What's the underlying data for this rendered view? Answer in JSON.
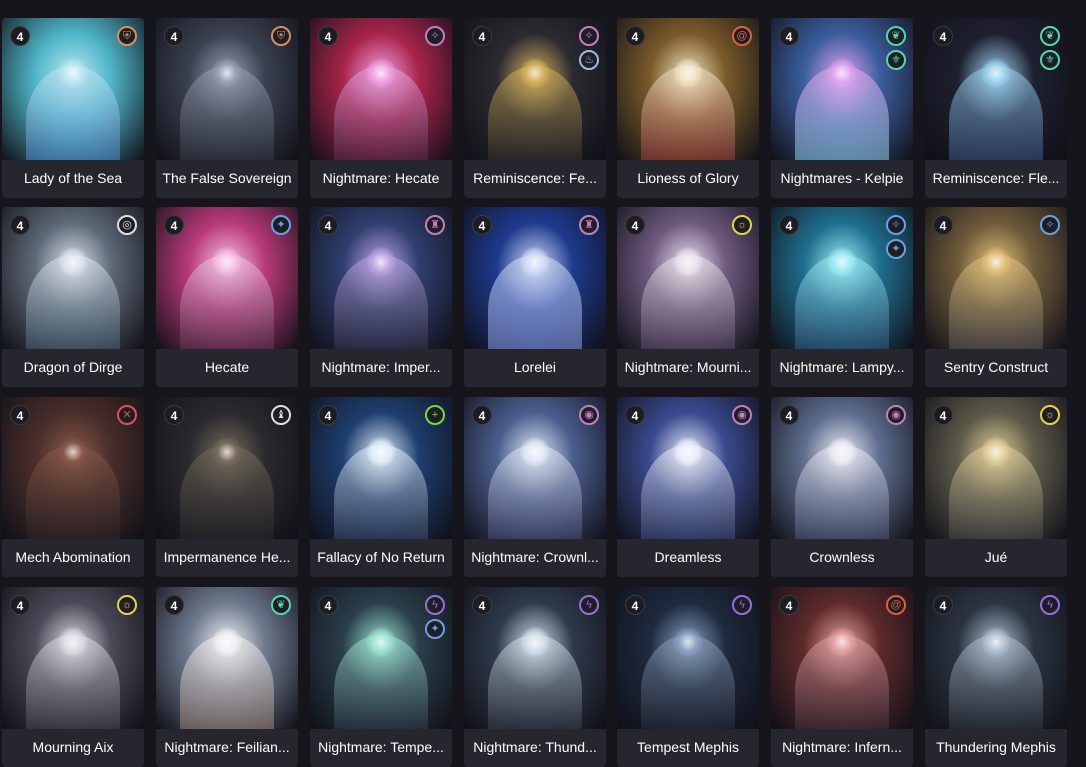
{
  "cards": [
    {
      "name": "Lady of the Sea",
      "level": "4",
      "colors": [
        "#4fb6c9",
        "#bfe9f3",
        "#3b78c4"
      ],
      "badges": [
        {
          "icon": "shield-icon",
          "color": "#d9905a",
          "glyph": "⛨"
        }
      ]
    },
    {
      "name": "The False Sovereign",
      "level": "4",
      "colors": [
        "#3b4150",
        "#9aa3b5",
        "#20242e"
      ],
      "badges": [
        {
          "icon": "shield-icon",
          "color": "#d9905a",
          "glyph": "⛨"
        }
      ]
    },
    {
      "name": "Nightmare: Hecate",
      "level": "4",
      "colors": [
        "#a8244a",
        "#f3a4e6",
        "#3e1530"
      ],
      "badges": [
        {
          "icon": "wings-icon",
          "color": "#c77ec0",
          "glyph": "✧"
        }
      ]
    },
    {
      "name": "Reminiscence: Fe...",
      "level": "4",
      "colors": [
        "#2a2a30",
        "#d9b45c",
        "#1a1a1f"
      ],
      "badges": [
        {
          "icon": "wings-icon",
          "color": "#c77ec0",
          "glyph": "✧"
        },
        {
          "icon": "flame-icon",
          "color": "#9fbbe0",
          "glyph": "♨"
        }
      ]
    },
    {
      "name": "Lioness of Glory",
      "level": "4",
      "colors": [
        "#7a5a2a",
        "#f3e6c4",
        "#8a2020"
      ],
      "badges": [
        {
          "icon": "spiral-icon",
          "color": "#e0603a",
          "glyph": "@"
        }
      ]
    },
    {
      "name": "Nightmares - Kelpie",
      "level": "4",
      "colors": [
        "#3b5e9e",
        "#e6a4f0",
        "#7fd6e6"
      ],
      "badges": [
        {
          "icon": "leaf-icon",
          "color": "#57d6a8",
          "glyph": "❦"
        },
        {
          "icon": "fleur-icon",
          "color": "#57d6a8",
          "glyph": "⚜"
        }
      ]
    },
    {
      "name": "Reminiscence: Fle...",
      "level": "4",
      "colors": [
        "#1e2030",
        "#9fd6f3",
        "#27406e"
      ],
      "badges": [
        {
          "icon": "leaf-icon",
          "color": "#57d6a8",
          "glyph": "❦"
        },
        {
          "icon": "fleur-icon",
          "color": "#57d6a8",
          "glyph": "⚜"
        }
      ]
    },
    {
      "name": "Dragon of Dirge",
      "level": "4",
      "colors": [
        "#5e6a78",
        "#dfe6ee",
        "#2e4a5e"
      ],
      "badges": [
        {
          "icon": "target-icon",
          "color": "#e0e0e0",
          "glyph": "◎"
        }
      ]
    },
    {
      "name": "Hecate",
      "level": "4",
      "colors": [
        "#b83a78",
        "#f8c4e8",
        "#4a1a3a"
      ],
      "badges": [
        {
          "icon": "sparkle-icon",
          "color": "#6e9fe6",
          "glyph": "✦"
        }
      ]
    },
    {
      "name": "Nightmare: Imper...",
      "level": "4",
      "colors": [
        "#2e3e6e",
        "#bfa8e6",
        "#1a1e2e"
      ],
      "badges": [
        {
          "icon": "tower-icon",
          "color": "#c77ec0",
          "glyph": "♜"
        }
      ]
    },
    {
      "name": "Lorelei",
      "level": "4",
      "colors": [
        "#1e3a8e",
        "#d6e0f8",
        "#7a8ede"
      ],
      "badges": [
        {
          "icon": "tower-icon",
          "color": "#c77ec0",
          "glyph": "♜"
        }
      ]
    },
    {
      "name": "Nightmare: Mourni...",
      "level": "4",
      "colors": [
        "#6e5a7e",
        "#f0e6f0",
        "#3a2e4a"
      ],
      "badges": [
        {
          "icon": "sun-icon",
          "color": "#e6d24a",
          "glyph": "☼"
        }
      ]
    },
    {
      "name": "Nightmare: Lampy...",
      "level": "4",
      "colors": [
        "#1e6e8e",
        "#9ff0f8",
        "#1e3e6e"
      ],
      "badges": [
        {
          "icon": "compass-icon",
          "color": "#6e9fe6",
          "glyph": "✧"
        },
        {
          "icon": "sparkle-icon",
          "color": "#6e9fe6",
          "glyph": "✦"
        }
      ]
    },
    {
      "name": "Sentry Construct",
      "level": "4",
      "colors": [
        "#6e5a3a",
        "#e6c47a",
        "#3a4050"
      ],
      "badges": [
        {
          "icon": "compass-icon",
          "color": "#6e9fe6",
          "glyph": "✧"
        }
      ]
    },
    {
      "name": "Mech Abomination",
      "level": "4",
      "colors": [
        "#4a2e2a",
        "#8a5a4a",
        "#1a1a1e"
      ],
      "badges": [
        {
          "icon": "swords-icon",
          "color": "#e05050",
          "glyph": "✕"
        }
      ]
    },
    {
      "name": "Impermanence He...",
      "level": "4",
      "colors": [
        "#2a2a2e",
        "#7a6e5e",
        "#1a1a1e"
      ],
      "badges": [
        {
          "icon": "chess-icon",
          "color": "#e0e0e0",
          "glyph": "♝"
        }
      ]
    },
    {
      "name": "Fallacy of No Return",
      "level": "4",
      "colors": [
        "#1e3e6e",
        "#e6f4ff",
        "#1a2a4a"
      ],
      "badges": [
        {
          "icon": "plus-icon",
          "color": "#7ad64a",
          "glyph": "+"
        }
      ]
    },
    {
      "name": "Nightmare: Crownl...",
      "level": "4",
      "colors": [
        "#4a5e8e",
        "#e6eef8",
        "#2a2e5e"
      ],
      "badges": [
        {
          "icon": "swirl-icon",
          "color": "#c77ec0",
          "glyph": "◉"
        }
      ]
    },
    {
      "name": "Dreamless",
      "level": "4",
      "colors": [
        "#3a4a8e",
        "#f0f4ff",
        "#1e2a5e"
      ],
      "badges": [
        {
          "icon": "swirl-icon",
          "color": "#c77ec0",
          "glyph": "◉"
        }
      ]
    },
    {
      "name": "Crownless",
      "level": "4",
      "colors": [
        "#5e6e8e",
        "#f0f0f8",
        "#2e3a5e"
      ],
      "badges": [
        {
          "icon": "swirl-icon",
          "color": "#c77ec0",
          "glyph": "◉"
        }
      ]
    },
    {
      "name": "Jué",
      "level": "4",
      "colors": [
        "#5e5a4a",
        "#e6d49a",
        "#2a2e3a"
      ],
      "badges": [
        {
          "icon": "sun-icon",
          "color": "#e6d24a",
          "glyph": "☼"
        }
      ]
    },
    {
      "name": "Mourning Aix",
      "level": "4",
      "colors": [
        "#4a4a58",
        "#e0e0ea",
        "#2a2a36"
      ],
      "badges": [
        {
          "icon": "sun-icon",
          "color": "#e6d24a",
          "glyph": "☼"
        }
      ]
    },
    {
      "name": "Nightmare: Feilian...",
      "level": "4",
      "colors": [
        "#6e7a8e",
        "#f4f4f8",
        "#8a6e5e"
      ],
      "badges": [
        {
          "icon": "leaf-icon",
          "color": "#57d6a8",
          "glyph": "❦"
        }
      ]
    },
    {
      "name": "Nightmare: Tempe...",
      "level": "4",
      "colors": [
        "#2a3e4a",
        "#9fe6d6",
        "#1a1e2e"
      ],
      "badges": [
        {
          "icon": "bolt-icon",
          "color": "#9a6ed6",
          "glyph": "ϟ"
        },
        {
          "icon": "sparkle-icon",
          "color": "#6e9fe6",
          "glyph": "✦"
        }
      ]
    },
    {
      "name": "Nightmare: Thund...",
      "level": "4",
      "colors": [
        "#2e3a4a",
        "#d6e6f0",
        "#1a1e2a"
      ],
      "badges": [
        {
          "icon": "bolt-icon",
          "color": "#9a6ed6",
          "glyph": "ϟ"
        }
      ]
    },
    {
      "name": "Tempest Mephis",
      "level": "4",
      "colors": [
        "#1e2a3e",
        "#8ea4c4",
        "#12161e"
      ],
      "badges": [
        {
          "icon": "bolt-icon",
          "color": "#9a6ed6",
          "glyph": "ϟ"
        }
      ]
    },
    {
      "name": "Nightmare: Infern...",
      "level": "4",
      "colors": [
        "#5e2a2a",
        "#e6a4a4",
        "#2a1a2a"
      ],
      "badges": [
        {
          "icon": "fire-swirl-icon",
          "color": "#e0603a",
          "glyph": "@"
        }
      ]
    },
    {
      "name": "Thundering Mephis",
      "level": "4",
      "colors": [
        "#2a3440",
        "#b4c4d6",
        "#161a22"
      ],
      "badges": [
        {
          "icon": "bolt-icon",
          "color": "#9a6ed6",
          "glyph": "ϟ"
        }
      ]
    }
  ]
}
